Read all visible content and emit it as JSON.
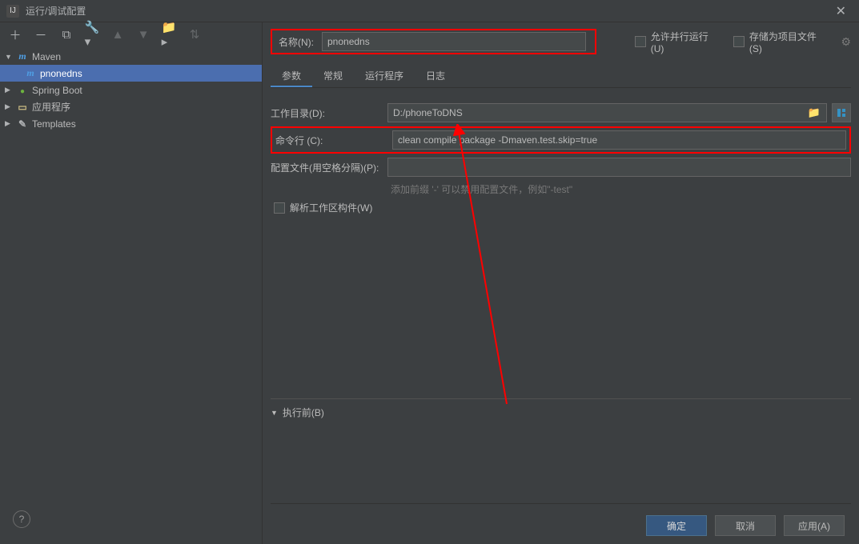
{
  "window": {
    "title": "运行/调试配置"
  },
  "tree": {
    "nodes": [
      {
        "label": "Maven",
        "icon": "m",
        "expanded": true
      },
      {
        "label": "pnonedns",
        "icon": "m",
        "child": true,
        "selected": true
      },
      {
        "label": "Spring Boot",
        "icon": "spring"
      },
      {
        "label": "应用程序",
        "icon": "app"
      },
      {
        "label": "Templates",
        "icon": "tmpl"
      }
    ]
  },
  "form": {
    "name_label": "名称(N):",
    "name_value": "pnonedns",
    "allow_parallel_label": "允许并行运行(U)",
    "store_as_file_label": "存储为项目文件(S)",
    "tabs": {
      "active": 0,
      "items": [
        "参数",
        "常规",
        "运行程序",
        "日志"
      ]
    },
    "workdir_label": "工作目录(D):",
    "workdir_value": "D:/phoneToDNS",
    "cmd_label": "命令行 (C):",
    "cmd_value": "clean compile package -Dmaven.test.skip=true",
    "profiles_label": "配置文件(用空格分隔)(P):",
    "profiles_value": "",
    "profiles_hint": "添加前缀 '-' 可以禁用配置文件，例如\"-test\"",
    "resolve_label": "解析工作区构件(W)",
    "before_exec_label": "执行前(B)"
  },
  "buttons": {
    "ok": "确定",
    "cancel": "取消",
    "apply": "应用(A)"
  }
}
